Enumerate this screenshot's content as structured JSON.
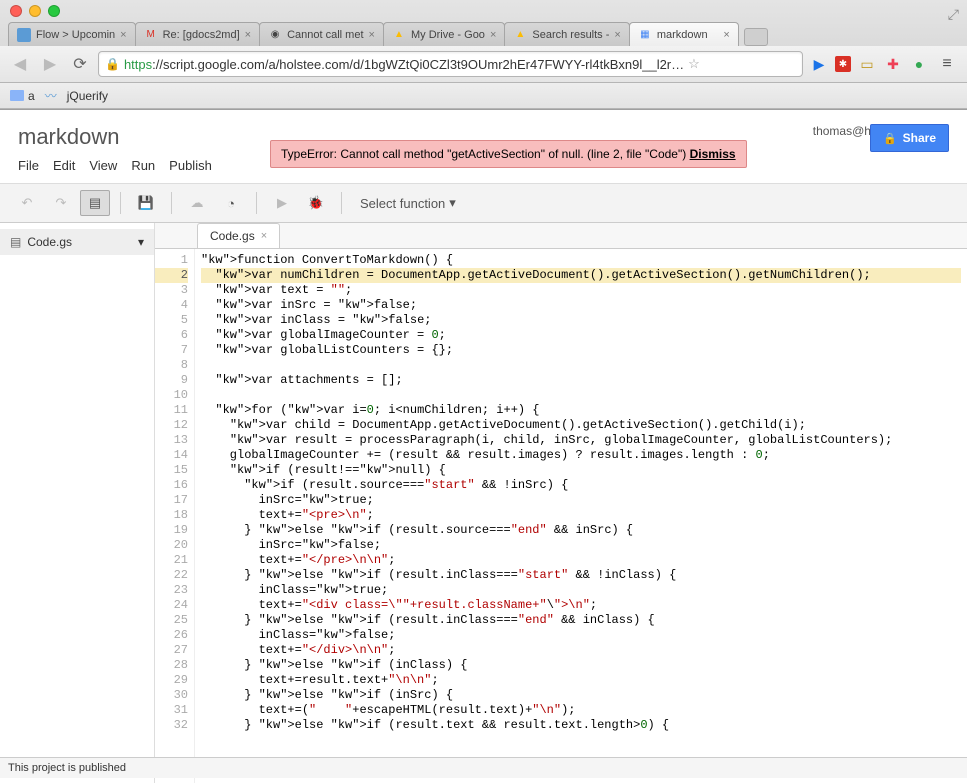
{
  "window": {
    "maximize_glyph": "⤢"
  },
  "tabs": [
    {
      "label": "Flow > Upcomin",
      "favicon_bg": "#5b9bd5"
    },
    {
      "label": "Re: [gdocs2md]",
      "favicon": "M",
      "favicon_color": "#d93025"
    },
    {
      "label": "Cannot call met",
      "favicon": "◉"
    },
    {
      "label": "My Drive - Goo",
      "favicon": "▲",
      "favicon_color": "#fbbc04"
    },
    {
      "label": "Search results -",
      "favicon": "▲",
      "favicon_color": "#fbbc04"
    },
    {
      "label": "markdown",
      "favicon": "▦",
      "favicon_color": "#4285f4",
      "active": true
    }
  ],
  "url": {
    "scheme": "https",
    "rest": "://script.google.com/a/holstee.com/d/1bgWZtQi0CZl3t9OUmr2hEr47FWYY-rl4tkBxn9l__l2r…"
  },
  "bookmarks": [
    {
      "label": "a",
      "type": "folder"
    },
    {
      "label": "",
      "type": "icon"
    },
    {
      "label": "jQuerify",
      "type": "link"
    }
  ],
  "app": {
    "title": "markdown",
    "user_email": "thomas@holstee.com",
    "share_label": "Share",
    "menus": [
      "File",
      "Edit",
      "View",
      "Run",
      "Publish"
    ],
    "error": {
      "message": "TypeError: Cannot call method \"getActiveSection\" of null. (line 2, file \"Code\")",
      "dismiss": "Dismiss"
    },
    "select_fn": "Select function"
  },
  "sidebar": {
    "files": [
      {
        "name": "Code.gs"
      }
    ]
  },
  "editor": {
    "open_tab": "Code.gs",
    "highlighted_line": 2,
    "lines": [
      "function ConvertToMarkdown() {",
      "  var numChildren = DocumentApp.getActiveDocument().getActiveSection().getNumChildren();",
      "  var text = \"\";",
      "  var inSrc = false;",
      "  var inClass = false;",
      "  var globalImageCounter = 0;",
      "  var globalListCounters = {};",
      "",
      "  var attachments = [];",
      "",
      "  for (var i=0; i<numChildren; i++) {",
      "    var child = DocumentApp.getActiveDocument().getActiveSection().getChild(i);",
      "    var result = processParagraph(i, child, inSrc, globalImageCounter, globalListCounters);",
      "    globalImageCounter += (result && result.images) ? result.images.length : 0;",
      "    if (result!==null) {",
      "      if (result.source===\"start\" && !inSrc) {",
      "        inSrc=true;",
      "        text+=\"<pre>\\n\";",
      "      } else if (result.source===\"end\" && inSrc) {",
      "        inSrc=false;",
      "        text+=\"</pre>\\n\\n\";",
      "      } else if (result.inClass===\"start\" && !inClass) {",
      "        inClass=true;",
      "        text+=\"<div class=\\\"\"+result.className+\"\\\">\\n\";",
      "      } else if (result.inClass===\"end\" && inClass) {",
      "        inClass=false;",
      "        text+=\"</div>\\n\\n\";",
      "      } else if (inClass) {",
      "        text+=result.text+\"\\n\\n\";",
      "      } else if (inSrc) {",
      "        text+=(\"    \"+escapeHTML(result.text)+\"\\n\");",
      "      } else if (result.text && result.text.length>0) {"
    ]
  },
  "footer": {
    "status": "This project is published"
  }
}
